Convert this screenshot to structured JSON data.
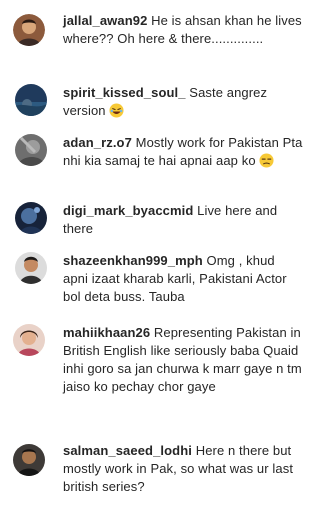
{
  "comments": [
    {
      "username": "jallal_awan92",
      "text": "He is ahsan khan he lives where?? Oh here & there..............",
      "avatar_icon": "avatar-photo"
    },
    {
      "username": "spirit_kissed_soul_",
      "text": "Saste angrez version",
      "emoji": "laughing-face",
      "avatar_icon": "avatar-photo"
    },
    {
      "username": "adan_rz.o7",
      "text": "Mostly work for Pakistan Pta nhi kia samaj te hai apnai aap ko",
      "emoji": "unamused-face",
      "avatar_icon": "avatar-photo"
    },
    {
      "username": "digi_mark_byaccmid",
      "text": "Live here and there",
      "avatar_icon": "avatar-photo"
    },
    {
      "username": "shazeenkhan999_mph",
      "text": "Omg , khud apni izaat kharab karli, Pakistani Actor bol deta buss. Tauba",
      "avatar_icon": "avatar-photo"
    },
    {
      "username": "mahiikhaan26",
      "text": "Representing Pakistan in British English like seriously baba Quaid inhi goro sa jan churwa k marr gaye n tm jaiso ko pechay chor gaye",
      "avatar_icon": "avatar-photo"
    },
    {
      "username": "salman_saeed_lodhi",
      "text": "Here n there but mostly work in Pak, so what was ur last british series?",
      "avatar_icon": "avatar-photo"
    }
  ]
}
